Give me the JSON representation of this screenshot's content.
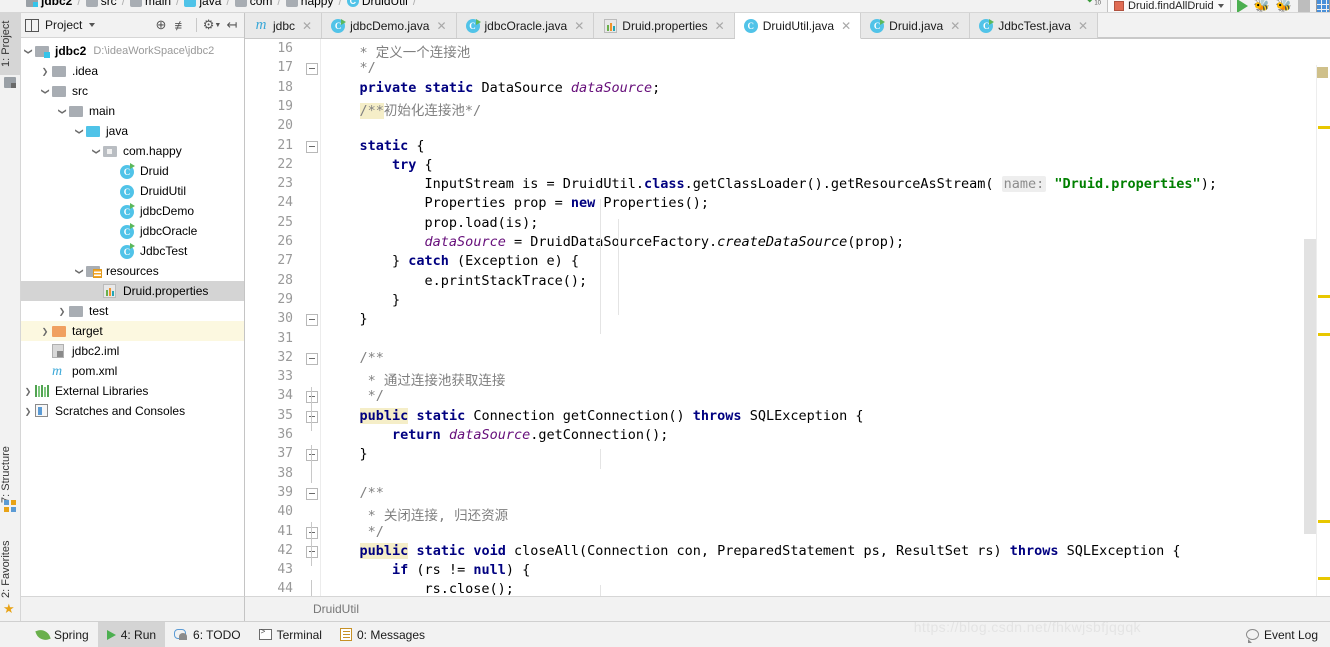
{
  "breadcrumb": {
    "items": [
      {
        "label": "jdbc2",
        "icon": "module-icon",
        "bold": true
      },
      {
        "label": "src",
        "icon": "folder-icon",
        "bold": false
      },
      {
        "label": "main",
        "icon": "folder-icon",
        "bold": false
      },
      {
        "label": "java",
        "icon": "source-folder-icon",
        "bold": false
      },
      {
        "label": "com",
        "icon": "folder-icon",
        "bold": false
      },
      {
        "label": "happy",
        "icon": "folder-icon",
        "bold": false
      },
      {
        "label": "DruidUtil",
        "icon": "class-icon",
        "bold": false
      }
    ]
  },
  "toolbar": {
    "run_config": "Druid.findAllDruid",
    "run_button": "run-icon",
    "debug_button": "debug-icon",
    "coverage_button": "coverage-icon",
    "stop_button": "stop-icon",
    "layout_button": "layout-icon"
  },
  "left_rail": {
    "tabs": [
      {
        "label": "1: Project",
        "shortcut": "1",
        "active": true
      },
      {
        "label": "7: Structure",
        "shortcut": "7",
        "active": false
      },
      {
        "label": "2: Favorites",
        "shortcut": "2",
        "active": false
      }
    ]
  },
  "project_panel": {
    "title": "Project",
    "header_buttons": [
      "locate-icon",
      "collapse-all-icon",
      "settings-icon",
      "hide-icon"
    ],
    "tree": [
      {
        "depth": 0,
        "arrow": "down",
        "icon": "module-icon",
        "label": "jdbc2",
        "bold": true,
        "path": "D:\\ideaWorkSpace\\jdbc2",
        "state": "none"
      },
      {
        "depth": 1,
        "arrow": "right",
        "icon": "folder-icon",
        "label": ".idea",
        "bold": false,
        "path": "",
        "state": "none"
      },
      {
        "depth": 1,
        "arrow": "down",
        "icon": "folder-icon",
        "label": "src",
        "bold": false,
        "path": "",
        "state": "none"
      },
      {
        "depth": 2,
        "arrow": "down",
        "icon": "folder-icon",
        "label": "main",
        "bold": false,
        "path": "",
        "state": "none"
      },
      {
        "depth": 3,
        "arrow": "down",
        "icon": "source-folder-icon",
        "label": "java",
        "bold": false,
        "path": "",
        "state": "none"
      },
      {
        "depth": 4,
        "arrow": "down",
        "icon": "package-icon",
        "label": "com.happy",
        "bold": false,
        "path": "",
        "state": "none"
      },
      {
        "depth": 5,
        "arrow": "none",
        "icon": "class-runnable-icon",
        "label": "Druid",
        "bold": false,
        "path": "",
        "state": "none"
      },
      {
        "depth": 5,
        "arrow": "none",
        "icon": "class-icon",
        "label": "DruidUtil",
        "bold": false,
        "path": "",
        "state": "none"
      },
      {
        "depth": 5,
        "arrow": "none",
        "icon": "class-runnable-icon",
        "label": "jdbcDemo",
        "bold": false,
        "path": "",
        "state": "none"
      },
      {
        "depth": 5,
        "arrow": "none",
        "icon": "class-runnable-icon",
        "label": "jdbcOracle",
        "bold": false,
        "path": "",
        "state": "none"
      },
      {
        "depth": 5,
        "arrow": "none",
        "icon": "class-runnable-icon",
        "label": "JdbcTest",
        "bold": false,
        "path": "",
        "state": "none"
      },
      {
        "depth": 3,
        "arrow": "down",
        "icon": "resources-folder-icon",
        "label": "resources",
        "bold": false,
        "path": "",
        "state": "none"
      },
      {
        "depth": 4,
        "arrow": "none",
        "icon": "properties-icon",
        "label": "Druid.properties",
        "bold": false,
        "path": "",
        "state": "selected"
      },
      {
        "depth": 2,
        "arrow": "right",
        "icon": "folder-icon",
        "label": "test",
        "bold": false,
        "path": "",
        "state": "none"
      },
      {
        "depth": 1,
        "arrow": "right",
        "icon": "target-folder-icon",
        "label": "target",
        "bold": false,
        "path": "",
        "state": "highlight"
      },
      {
        "depth": 1,
        "arrow": "none",
        "icon": "iml-icon",
        "label": "jdbc2.iml",
        "bold": false,
        "path": "",
        "state": "none"
      },
      {
        "depth": 1,
        "arrow": "none",
        "icon": "maven-icon",
        "label": "pom.xml",
        "bold": false,
        "path": "",
        "state": "none"
      },
      {
        "depth": 0,
        "arrow": "right",
        "icon": "library-icon",
        "label": "External Libraries",
        "bold": false,
        "path": "",
        "state": "none"
      },
      {
        "depth": 0,
        "arrow": "right",
        "icon": "scratches-icon",
        "label": "Scratches and Consoles",
        "bold": false,
        "path": "",
        "state": "none"
      }
    ]
  },
  "editor": {
    "tabs": [
      {
        "label": "jdbc",
        "icon": "maven-icon",
        "active": false
      },
      {
        "label": "jdbcDemo.java",
        "icon": "class-runnable-icon",
        "active": false
      },
      {
        "label": "jdbcOracle.java",
        "icon": "class-runnable-icon",
        "active": false
      },
      {
        "label": "Druid.properties",
        "icon": "properties-icon",
        "active": false
      },
      {
        "label": "DruidUtil.java",
        "icon": "class-icon",
        "active": true
      },
      {
        "label": "Druid.java",
        "icon": "class-runnable-icon",
        "active": false
      },
      {
        "label": "JdbcTest.java",
        "icon": "class-runnable-icon",
        "active": false
      }
    ],
    "breadcrumb_status": "DruidUtil",
    "first_line_number": 16,
    "lines": [
      {
        "num": 16,
        "fold": "none",
        "tokens": [
          {
            "t": "    * 定义一个连接池",
            "c": "cmt"
          }
        ]
      },
      {
        "num": 17,
        "fold": "end",
        "tokens": [
          {
            "t": "    */",
            "c": "cmt"
          }
        ]
      },
      {
        "num": 18,
        "fold": "none",
        "tokens": [
          {
            "t": "    ",
            "c": "plain"
          },
          {
            "t": "private static",
            "c": "kw"
          },
          {
            "t": " DataSource ",
            "c": "plain"
          },
          {
            "t": "dataSource",
            "c": "fld"
          },
          {
            "t": ";",
            "c": "plain"
          }
        ]
      },
      {
        "num": 19,
        "fold": "none",
        "tokens": [
          {
            "t": "    ",
            "c": "plain"
          },
          {
            "t": "/**",
            "c": "cmt hlt"
          },
          {
            "t": "初始化连接池*/",
            "c": "cmt"
          }
        ]
      },
      {
        "num": 20,
        "fold": "none",
        "tokens": []
      },
      {
        "num": 21,
        "fold": "start",
        "tokens": [
          {
            "t": "    ",
            "c": "plain"
          },
          {
            "t": "static",
            "c": "kw"
          },
          {
            "t": " {",
            "c": "plain"
          }
        ]
      },
      {
        "num": 22,
        "fold": "none",
        "tokens": [
          {
            "t": "        ",
            "c": "plain"
          },
          {
            "t": "try",
            "c": "kw"
          },
          {
            "t": " {",
            "c": "plain"
          }
        ]
      },
      {
        "num": 23,
        "fold": "none",
        "tokens": [
          {
            "t": "            InputStream is = DruidUtil.",
            "c": "plain"
          },
          {
            "t": "class",
            "c": "kw"
          },
          {
            "t": ".getClassLoader().getResourceAsStream( ",
            "c": "plain"
          },
          {
            "t": "name:",
            "c": "hint"
          },
          {
            "t": " ",
            "c": "plain"
          },
          {
            "t": "\"Druid.properties\"",
            "c": "str"
          },
          {
            "t": ");",
            "c": "plain"
          }
        ]
      },
      {
        "num": 24,
        "fold": "none",
        "tokens": [
          {
            "t": "            Properties prop = ",
            "c": "plain"
          },
          {
            "t": "new",
            "c": "kw"
          },
          {
            "t": " Properties();",
            "c": "plain"
          }
        ]
      },
      {
        "num": 25,
        "fold": "none",
        "tokens": [
          {
            "t": "            prop.load(is);",
            "c": "plain"
          }
        ]
      },
      {
        "num": 26,
        "fold": "none",
        "tokens": [
          {
            "t": "            ",
            "c": "plain"
          },
          {
            "t": "dataSource",
            "c": "fld"
          },
          {
            "t": " = DruidDataSourceFactory.",
            "c": "plain"
          },
          {
            "t": "createDataSource",
            "c": "mtd"
          },
          {
            "t": "(prop);",
            "c": "plain"
          }
        ]
      },
      {
        "num": 27,
        "fold": "none",
        "tokens": [
          {
            "t": "        } ",
            "c": "plain"
          },
          {
            "t": "catch",
            "c": "kw"
          },
          {
            "t": " (Exception e) {",
            "c": "plain"
          }
        ]
      },
      {
        "num": 28,
        "fold": "none",
        "tokens": [
          {
            "t": "            e.printStackTrace();",
            "c": "plain"
          }
        ]
      },
      {
        "num": 29,
        "fold": "none",
        "tokens": [
          {
            "t": "        }",
            "c": "plain"
          }
        ]
      },
      {
        "num": 30,
        "fold": "end",
        "tokens": [
          {
            "t": "    }",
            "c": "plain"
          }
        ]
      },
      {
        "num": 31,
        "fold": "none",
        "tokens": []
      },
      {
        "num": 32,
        "fold": "start",
        "tokens": [
          {
            "t": "    /**",
            "c": "cmt"
          }
        ]
      },
      {
        "num": 33,
        "fold": "none",
        "tokens": [
          {
            "t": "     * 通过连接池获取连接",
            "c": "cmt"
          }
        ]
      },
      {
        "num": 34,
        "fold": "end",
        "tokens": [
          {
            "t": "     */",
            "c": "cmt"
          }
        ]
      },
      {
        "num": 35,
        "fold": "start",
        "tokens": [
          {
            "t": "    ",
            "c": "plain"
          },
          {
            "t": "public",
            "c": "kw hlt"
          },
          {
            "t": " ",
            "c": "plain"
          },
          {
            "t": "static",
            "c": "kw"
          },
          {
            "t": " Connection getConnection() ",
            "c": "plain"
          },
          {
            "t": "throws",
            "c": "kw"
          },
          {
            "t": " SQLException {",
            "c": "plain"
          }
        ]
      },
      {
        "num": 36,
        "fold": "none",
        "tokens": [
          {
            "t": "        ",
            "c": "plain"
          },
          {
            "t": "return",
            "c": "kw"
          },
          {
            "t": " ",
            "c": "plain"
          },
          {
            "t": "dataSource",
            "c": "fld"
          },
          {
            "t": ".getConnection();",
            "c": "plain"
          }
        ]
      },
      {
        "num": 37,
        "fold": "end",
        "tokens": [
          {
            "t": "    }",
            "c": "plain"
          }
        ]
      },
      {
        "num": 38,
        "fold": "none",
        "tokens": []
      },
      {
        "num": 39,
        "fold": "start",
        "tokens": [
          {
            "t": "    /**",
            "c": "cmt"
          }
        ]
      },
      {
        "num": 40,
        "fold": "none",
        "tokens": [
          {
            "t": "     * 关闭连接, 归还资源",
            "c": "cmt"
          }
        ]
      },
      {
        "num": 41,
        "fold": "end",
        "tokens": [
          {
            "t": "     */",
            "c": "cmt"
          }
        ]
      },
      {
        "num": 42,
        "fold": "start",
        "tokens": [
          {
            "t": "    ",
            "c": "plain"
          },
          {
            "t": "public",
            "c": "kw hlt"
          },
          {
            "t": " ",
            "c": "plain"
          },
          {
            "t": "static void",
            "c": "kw"
          },
          {
            "t": " closeAll(Connection con, PreparedStatement ps, ResultSet rs) ",
            "c": "plain"
          },
          {
            "t": "throws",
            "c": "kw"
          },
          {
            "t": " SQLException {",
            "c": "plain"
          }
        ]
      },
      {
        "num": 43,
        "fold": "none",
        "tokens": [
          {
            "t": "        ",
            "c": "plain"
          },
          {
            "t": "if",
            "c": "kw"
          },
          {
            "t": " (rs != ",
            "c": "plain"
          },
          {
            "t": "null",
            "c": "kw"
          },
          {
            "t": ") {",
            "c": "plain"
          }
        ]
      },
      {
        "num": 44,
        "fold": "none",
        "tokens": [
          {
            "t": "            rs.close();",
            "c": "plain"
          }
        ]
      }
    ],
    "marker_color": "#e8c700",
    "markers_y": [
      61,
      230,
      268,
      455,
      512
    ]
  },
  "status_bar": {
    "buttons": [
      {
        "label": "Spring",
        "icon": "spring-leaf-icon",
        "shortcut": "",
        "active": false
      },
      {
        "label": "4: Run",
        "icon": "run-icon",
        "shortcut": "4",
        "active": true
      },
      {
        "label": "6: TODO",
        "icon": "todo-icon",
        "shortcut": "6",
        "active": false
      },
      {
        "label": "Terminal",
        "icon": "terminal-icon",
        "shortcut": "",
        "active": false
      },
      {
        "label": "0: Messages",
        "icon": "messages-icon",
        "shortcut": "0",
        "active": false
      }
    ],
    "watermark": "https://blog.csdn.net/fhkwjsbfjqgqk",
    "event_log": "Event Log"
  }
}
